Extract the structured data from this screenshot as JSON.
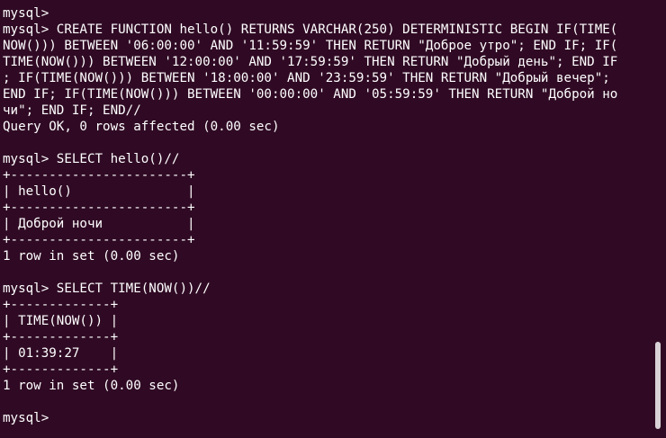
{
  "terminal": {
    "lines": [
      "mysql>",
      "mysql> CREATE FUNCTION hello() RETURNS VARCHAR(250) DETERMINISTIC BEGIN IF(TIME(",
      "NOW())) BETWEEN '06:00:00' AND '11:59:59' THEN RETURN \"Доброе утро\"; END IF; IF(",
      "TIME(NOW())) BETWEEN '12:00:00' AND '17:59:59' THEN RETURN \"Добрый день\"; END IF",
      "; IF(TIME(NOW())) BETWEEN '18:00:00' AND '23:59:59' THEN RETURN \"Добрый вечер\";",
      "END IF; IF(TIME(NOW())) BETWEEN '00:00:00' AND '05:59:59' THEN RETURN \"Доброй но",
      "чи\"; END IF; END//",
      "Query OK, 0 rows affected (0.00 sec)",
      "",
      "mysql> SELECT hello()//",
      "+-----------------------+",
      "| hello()               |",
      "+-----------------------+",
      "| Доброй ночи           |",
      "+-----------------------+",
      "1 row in set (0.00 sec)",
      "",
      "mysql> SELECT TIME(NOW())//",
      "+-------------+",
      "| TIME(NOW()) |",
      "+-------------+",
      "| 01:39:27    |",
      "+-------------+",
      "1 row in set (0.00 sec)",
      "",
      "mysql> "
    ]
  },
  "colors": {
    "background": "#300a24",
    "foreground": "#ffffff",
    "scrollbar_thumb": "#d8d2d6"
  }
}
